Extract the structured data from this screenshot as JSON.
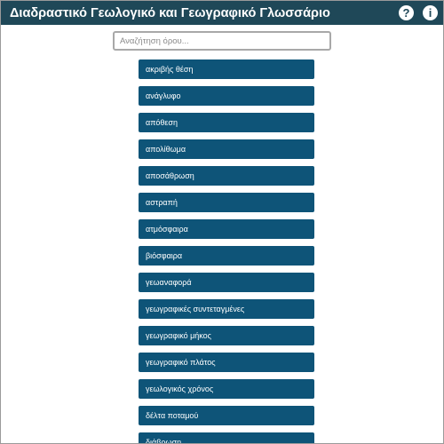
{
  "app": {
    "title": "Διαδραστικό Γεωλογικό και Γεωγραφικό Γλωσσάριο"
  },
  "header": {
    "help_icon_glyph": "?",
    "info_icon_glyph": "i"
  },
  "search": {
    "placeholder": "Αναζήτηση όρου...",
    "value": ""
  },
  "terms": [
    "ακριβής θέση",
    "ανάγλυφο",
    "απόθεση",
    "απολίθωμα",
    "αποσάθρωση",
    "αστραπή",
    "ατμόσφαιρα",
    "βιόσφαιρα",
    "γεωαναφορά",
    "γεωγραφικές συντεταγμένες",
    "γεωγραφικό μήκος",
    "γεωγραφικό πλάτος",
    "γεωλογικός χρόνος",
    "δέλτα ποταμού",
    "διάβρωση"
  ],
  "colors": {
    "header_bg": "#1f4858",
    "term_bg": "#0e5478",
    "term_text": "#ffffff"
  }
}
